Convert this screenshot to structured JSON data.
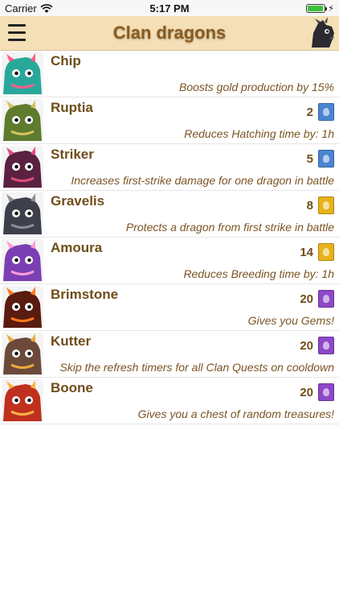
{
  "status": {
    "carrier": "Carrier",
    "time": "5:17 PM"
  },
  "header": {
    "title": "Clan dragons"
  },
  "colors": {
    "rare": "#4a84d4",
    "epic": "#e7b21b",
    "legendary": "#8d47c9"
  },
  "dragons": [
    {
      "name": "Chip",
      "level": "",
      "rarity": "",
      "description": "Boosts gold production by 15%",
      "color": "#28a89a",
      "accent": "#ff5c8a"
    },
    {
      "name": "Ruptia",
      "level": "2",
      "rarity": "rare",
      "description": "Reduces Hatching time by: 1h",
      "color": "#5e7b2e",
      "accent": "#d7c25a"
    },
    {
      "name": "Striker",
      "level": "5",
      "rarity": "rare",
      "description": "Increases first-strike damage for one dragon in battle",
      "color": "#5a2240",
      "accent": "#e04a7d"
    },
    {
      "name": "Gravelis",
      "level": "8",
      "rarity": "epic",
      "description": "Protects a dragon from first strike in battle",
      "color": "#3d3f4a",
      "accent": "#8a8d98"
    },
    {
      "name": "Amoura",
      "level": "14",
      "rarity": "epic",
      "description": "Reduces Breeding time by: 1h",
      "color": "#7b3fb4",
      "accent": "#ff9cd6"
    },
    {
      "name": "Brimstone",
      "level": "20",
      "rarity": "legendary",
      "description": "Gives you Gems!",
      "color": "#5a1b10",
      "accent": "#ff7a1a"
    },
    {
      "name": "Kutter",
      "level": "20",
      "rarity": "legendary",
      "description": "Skip the refresh timers for all Clan Quests on cooldown",
      "color": "#6b4a3b",
      "accent": "#f0a93a"
    },
    {
      "name": "Boone",
      "level": "20",
      "rarity": "legendary",
      "description": "Gives you a chest of random treasures!",
      "color": "#c0301f",
      "accent": "#ffb347"
    }
  ]
}
